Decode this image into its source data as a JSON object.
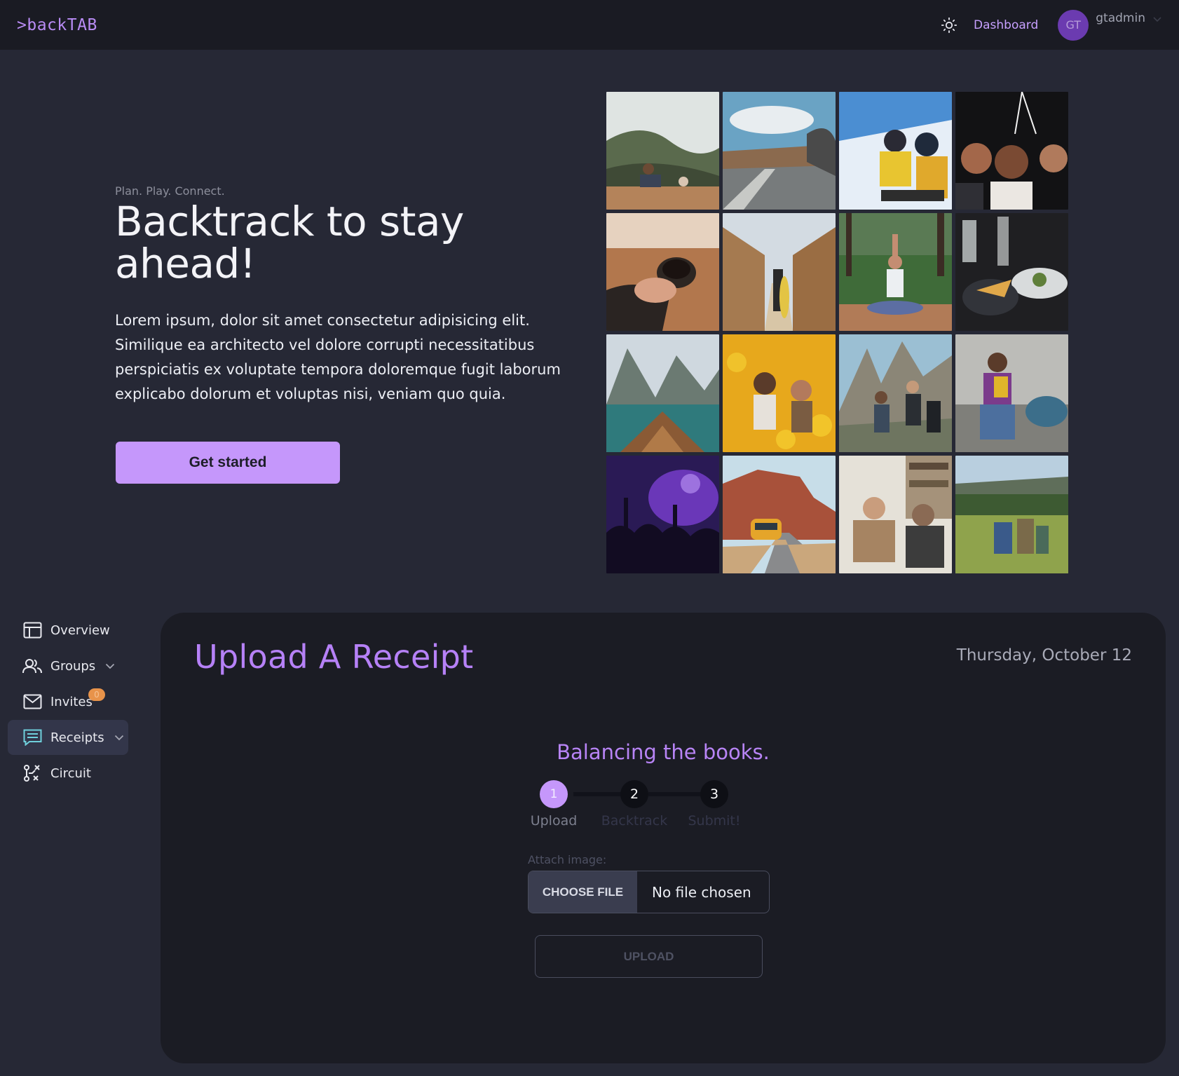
{
  "header": {
    "logo_prefix": ">",
    "logo_text": "backTAB",
    "nav_link": "Dashboard",
    "avatar_initials": "GT",
    "username": "gtadmin"
  },
  "hero": {
    "tagline": "Plan. Play. Connect.",
    "title": "Backtrack to stay ahead!",
    "body": "Lorem ipsum, dolor sit amet consectetur adipisicing elit. Similique ea architecto vel dolore corrupti necessitatibus perspiciatis ex voluptate tempora doloremque fugit laborum explicabo dolorum et voluptas nisi, veniam quo quia.",
    "cta_label": "Get started"
  },
  "sidebar": {
    "items": [
      {
        "label": "Overview",
        "icon": "layout-icon"
      },
      {
        "label": "Groups",
        "icon": "users-icon",
        "has_chevron": true
      },
      {
        "label": "Invites",
        "icon": "mail-icon",
        "badge": "0"
      },
      {
        "label": "Receipts",
        "icon": "receipt-icon",
        "has_chevron": true,
        "active": true
      },
      {
        "label": "Circuit",
        "icon": "circuit-icon"
      }
    ]
  },
  "main": {
    "title": "Upload A Receipt",
    "date": "Thursday, October 12",
    "subheading": "Balancing the books.",
    "steps": [
      {
        "number": "1",
        "label": "Upload",
        "active": true
      },
      {
        "number": "2",
        "label": "Backtrack",
        "active": false
      },
      {
        "number": "3",
        "label": "Submit!",
        "active": false
      }
    ],
    "attach_label": "Attach image:",
    "choose_file_label": "CHOOSE FILE",
    "file_status": "No file chosen",
    "upload_label": "UPLOAD"
  },
  "colors": {
    "accent": "#b681f7",
    "button": "#c597fb",
    "navbar_bg": "#1a1b23",
    "page_bg": "#262835",
    "card_bg": "#1b1c24",
    "badge": "#e8934a"
  },
  "photos": [
    "photo-friends-on-cliff",
    "photo-road-trip-dog",
    "photo-skiers-chairlift",
    "photo-party-crowd",
    "photo-coffee-cups",
    "photo-surfer-boardwalk",
    "photo-yoga-forest",
    "photo-dinner-table",
    "photo-lake-boat",
    "photo-sunflower-field",
    "photo-hikers-mountains",
    "photo-friends-couch",
    "photo-concert",
    "photo-van-desert",
    "photo-friends-cafe",
    "photo-hikers-meadow"
  ]
}
